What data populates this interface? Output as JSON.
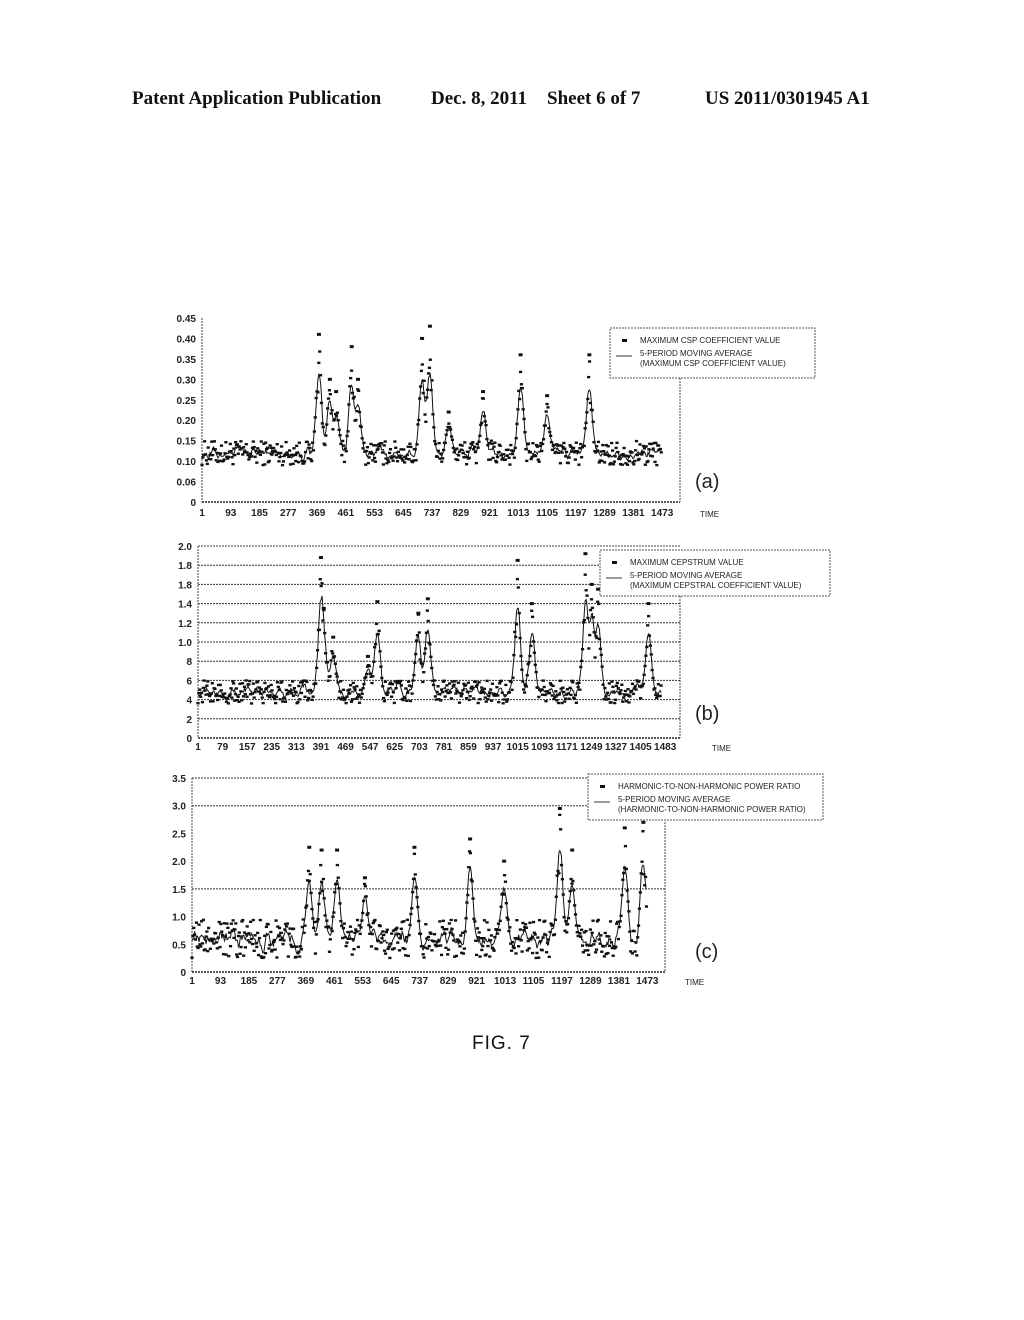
{
  "header": {
    "left": "Patent Application Publication",
    "date": "Dec. 8, 2011",
    "sheet": "Sheet 6 of 7",
    "number": "US 2011/0301945 A1"
  },
  "figure_label": "FIG. 7",
  "chart_data": [
    {
      "type": "scatter",
      "panel_label": "(a)",
      "xlabel": "TIME",
      "ylabel": "",
      "xlim": [
        1,
        1530
      ],
      "ylim": [
        0,
        0.45
      ],
      "y_ticks": [
        0,
        0.05,
        0.1,
        0.15,
        0.2,
        0.25,
        0.3,
        0.35,
        0.4,
        0.45
      ],
      "y_tick_labels": [
        "0",
        "0.06",
        "0.10",
        "0.15",
        "0.20",
        "0.25",
        "0.30",
        "0.35",
        "0.40",
        "0.45"
      ],
      "x_ticks": [
        1,
        93,
        185,
        277,
        369,
        461,
        553,
        645,
        737,
        829,
        921,
        1013,
        1105,
        1197,
        1289,
        1381,
        1473
      ],
      "x_tick_labels": [
        "1",
        "93",
        "185",
        "277",
        "369",
        "461",
        "553",
        "645",
        "737",
        "829",
        "921",
        "1013",
        "1105",
        "1197",
        "1289",
        "1381",
        "1473"
      ],
      "grid": false,
      "legend_position": "top-right",
      "baseline": 0.12,
      "noise": 0.03,
      "peaks": [
        {
          "x": 375,
          "y": 0.41
        },
        {
          "x": 410,
          "y": 0.3
        },
        {
          "x": 430,
          "y": 0.27
        },
        {
          "x": 480,
          "y": 0.38
        },
        {
          "x": 500,
          "y": 0.3
        },
        {
          "x": 705,
          "y": 0.4
        },
        {
          "x": 730,
          "y": 0.43
        },
        {
          "x": 790,
          "y": 0.22
        },
        {
          "x": 900,
          "y": 0.27
        },
        {
          "x": 1020,
          "y": 0.36
        },
        {
          "x": 1105,
          "y": 0.26
        },
        {
          "x": 1240,
          "y": 0.36
        }
      ],
      "series": [
        {
          "name": "MAXIMUM CSP COEFFICIENT VALUE",
          "style": "markers"
        },
        {
          "name": "5-PERIOD MOVING AVERAGE",
          "name_line2": "(MAXIMUM CSP COEFFICIENT VALUE)",
          "style": "line"
        }
      ]
    },
    {
      "type": "scatter",
      "panel_label": "(b)",
      "xlabel": "TIME",
      "ylabel": "",
      "xlim": [
        1,
        1530
      ],
      "ylim": [
        0,
        2.0
      ],
      "y_ticks": [
        0,
        0.2,
        0.4,
        0.6,
        0.8,
        1.0,
        1.2,
        1.4,
        1.6,
        1.8,
        2.0
      ],
      "y_tick_labels": [
        "0",
        "2",
        "4",
        "6",
        "8",
        "1.0",
        "1.2",
        "1.4",
        "1.8",
        "1.8",
        "2.0"
      ],
      "x_ticks": [
        1,
        79,
        157,
        235,
        313,
        391,
        469,
        547,
        625,
        703,
        781,
        859,
        937,
        1015,
        1093,
        1171,
        1249,
        1327,
        1405,
        1483
      ],
      "x_tick_labels": [
        "1",
        "79",
        "157",
        "235",
        "313",
        "391",
        "469",
        "547",
        "625",
        "703",
        "781",
        "859",
        "937",
        "1015",
        "1093",
        "1171",
        "1249",
        "1327",
        "1405",
        "1483"
      ],
      "grid": true,
      "legend_position": "top-right",
      "baseline": 0.48,
      "noise": 0.12,
      "peaks": [
        {
          "x": 391,
          "y": 1.88
        },
        {
          "x": 400,
          "y": 1.35
        },
        {
          "x": 430,
          "y": 1.05
        },
        {
          "x": 540,
          "y": 0.85
        },
        {
          "x": 570,
          "y": 1.42
        },
        {
          "x": 700,
          "y": 1.3
        },
        {
          "x": 730,
          "y": 1.45
        },
        {
          "x": 1015,
          "y": 1.85
        },
        {
          "x": 1060,
          "y": 1.4
        },
        {
          "x": 1230,
          "y": 1.92
        },
        {
          "x": 1250,
          "y": 1.6
        },
        {
          "x": 1270,
          "y": 1.55
        },
        {
          "x": 1430,
          "y": 1.4
        }
      ],
      "series": [
        {
          "name": "MAXIMUM CEPSTRUM VALUE",
          "style": "markers"
        },
        {
          "name": "5-PERIOD MOVING AVERAGE",
          "name_line2": "(MAXIMUM CEPSTRAL COEFFICIENT VALUE)",
          "style": "line"
        }
      ]
    },
    {
      "type": "scatter",
      "panel_label": "(c)",
      "xlabel": "TIME",
      "ylabel": "",
      "xlim": [
        1,
        1530
      ],
      "ylim": [
        0,
        3.5
      ],
      "y_ticks": [
        0,
        0.5,
        1.0,
        1.5,
        2.0,
        2.5,
        3.0,
        3.5
      ],
      "y_tick_labels": [
        "0",
        "0.5",
        "1.0",
        "1.5",
        "2.0",
        "2.5",
        "3.0",
        "3.5"
      ],
      "x_ticks": [
        1,
        93,
        185,
        277,
        369,
        461,
        553,
        645,
        737,
        829,
        921,
        1013,
        1105,
        1197,
        1289,
        1381,
        1473
      ],
      "x_tick_labels": [
        "1",
        "93",
        "185",
        "277",
        "369",
        "461",
        "553",
        "645",
        "737",
        "829",
        "921",
        "1013",
        "1105",
        "1197",
        "1289",
        "1381",
        "1473"
      ],
      "grid_lines": [
        1.5,
        3.0,
        3.5
      ],
      "legend_position": "top-right",
      "baseline": 0.6,
      "noise": 0.35,
      "peaks": [
        {
          "x": 380,
          "y": 2.25
        },
        {
          "x": 420,
          "y": 2.2
        },
        {
          "x": 470,
          "y": 2.2
        },
        {
          "x": 560,
          "y": 1.7
        },
        {
          "x": 720,
          "y": 2.25
        },
        {
          "x": 900,
          "y": 2.4
        },
        {
          "x": 1010,
          "y": 2.0
        },
        {
          "x": 1190,
          "y": 2.95
        },
        {
          "x": 1230,
          "y": 2.2
        },
        {
          "x": 1400,
          "y": 2.6
        },
        {
          "x": 1460,
          "y": 2.7
        }
      ],
      "series": [
        {
          "name": "HARMONIC-TO-NON-HARMONIC POWER RATIO",
          "style": "markers"
        },
        {
          "name": "5-PERIOD MOVING AVERAGE",
          "name_line2": "(HARMONIC-TO-NON-HARMONIC POWER RATIO)",
          "style": "line"
        }
      ]
    }
  ]
}
